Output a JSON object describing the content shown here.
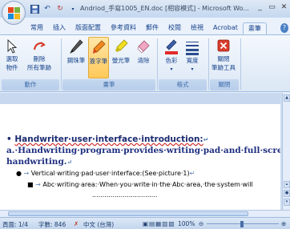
{
  "window": {
    "title": "Andriod_手寫1005_EN.doc [相容模式] - Microsoft Wo...",
    "controls": [
      "_",
      "▭",
      "✕"
    ]
  },
  "qat": {
    "undo": "↶",
    "redo": "↻"
  },
  "tabs": [
    "常用",
    "插入",
    "版面配置",
    "參考資料",
    "郵件",
    "校閱",
    "檢視",
    "Acrobat",
    "畫筆"
  ],
  "active_tab_index": 8,
  "help": "?",
  "ribbon": {
    "groups": [
      {
        "label": "動作",
        "buttons": [
          {
            "label": "選取物件",
            "icon": "select-arrow-icon"
          },
          {
            "label": "刪除",
            "icon": "eraser-icon"
          },
          {
            "label": "所有筆跡",
            "icon": "none"
          }
        ]
      },
      {
        "label": "畫筆",
        "buttons": [
          {
            "label": "鋼珠筆",
            "icon": "ballpoint-pen-icon"
          },
          {
            "label": "簽字筆",
            "icon": "felt-pen-icon"
          },
          {
            "label": "螢光筆",
            "icon": "highlighter-icon"
          },
          {
            "label": "清除",
            "icon": "pen-eraser-icon"
          }
        ]
      },
      {
        "label": "格式",
        "buttons": [
          {
            "label": "色彩",
            "icon": "color-icon"
          },
          {
            "label": "寬度",
            "icon": "width-icon"
          }
        ]
      },
      {
        "label": "關閉",
        "buttons": [
          {
            "label": "關閉",
            "icon": "close-ink-icon"
          },
          {
            "label": "筆跡工具",
            "icon": "none"
          }
        ]
      }
    ],
    "accent": "#f6a623"
  },
  "document": {
    "line1": "Handwriter·user·interface·introduction:",
    "line1_bullet": "•",
    "line2": "a.·Handwriting·program·provides·writing·pad·and·full·screen·",
    "line3": "handwriting.",
    "line4_bullet": "●",
    "line4": "Vertical·writing·pad·user·interface:(See·picture·1)",
    "line5_bullet": "■",
    "line5": "Abc·writing·area:·When·you·write·in·the·Abc·area,·the·system·will",
    "line6": "................................",
    "para_mark": "↵"
  },
  "status": {
    "page": "頁面: 1/4",
    "words": "字數: 846",
    "lang": "中文 (台灣)",
    "zoom": "100%"
  }
}
